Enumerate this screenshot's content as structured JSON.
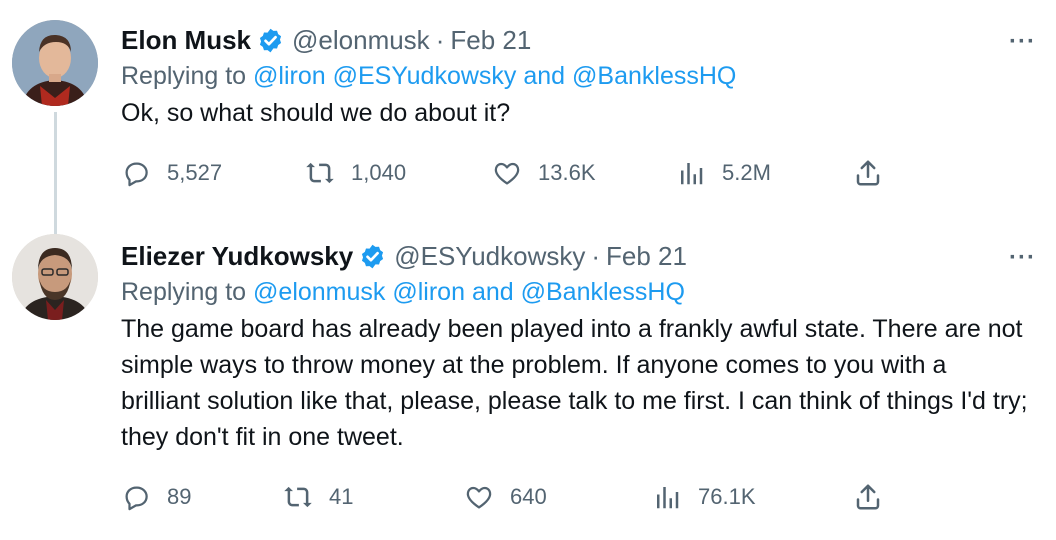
{
  "tweets": [
    {
      "name": "Elon Musk",
      "handle": "@elonmusk",
      "dot": "·",
      "date": "Feb 21",
      "more": "···",
      "replying_prefix": "Replying to",
      "mentions": [
        "@liron",
        "@ESYudkowsky",
        "and",
        "@BanklessHQ"
      ],
      "text": "Ok, so what should we do about it?",
      "stats": {
        "replies": "5,527",
        "retweets": "1,040",
        "likes": "13.6K",
        "views": "5.2M"
      }
    },
    {
      "name": "Eliezer Yudkowsky",
      "handle": "@ESYudkowsky",
      "dot": "·",
      "date": "Feb 21",
      "more": "···",
      "replying_prefix": "Replying to",
      "mentions": [
        "@elonmusk",
        "@liron",
        "and",
        "@BanklessHQ"
      ],
      "text": "The game board has already been played into a frankly awful state.  There are not simple ways to throw money at the problem.  If anyone comes to you with a brilliant solution like that, please, please talk to me first.  I can think of things I'd try; they don't fit in one tweet.",
      "stats": {
        "replies": "89",
        "retweets": "41",
        "likes": "640",
        "views": "76.1K"
      }
    }
  ],
  "icons": [
    "verified-badge-icon",
    "reply-icon",
    "retweet-icon",
    "like-icon",
    "views-icon",
    "share-icon"
  ],
  "colors": {
    "link": "#1d9bf0",
    "muted": "#536471",
    "verified": "#1d9bf0",
    "thread_line": "#cfd9de"
  }
}
